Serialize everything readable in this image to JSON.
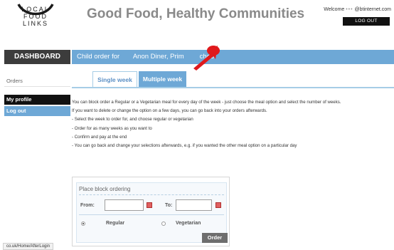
{
  "branding": {
    "logo_lines": [
      "LOCAL",
      "FOOD",
      "LINKS"
    ],
    "site_title": "Good Food, Healthy Communities"
  },
  "account": {
    "welcome_label": "Welcome",
    "email_masked": "•••",
    "email_domain": "@btinternet.com",
    "logout_label": "LOG OUT"
  },
  "nav": {
    "dashboard_label": "DASHBOARD",
    "sidebar": {
      "section_label": "Orders",
      "items": [
        {
          "label": "My profile",
          "active": true
        },
        {
          "label": "Log out",
          "active": false
        }
      ]
    }
  },
  "header": {
    "prefix": "Child order for",
    "child_name": "Anon Diner,",
    "school_partial": "Prim",
    "school_suffix": "chool"
  },
  "tabs": [
    {
      "label": "Single week",
      "active": false
    },
    {
      "label": "Multiple week",
      "active": true
    }
  ],
  "instructions": {
    "intro": "You can block order a Regular or a Vegetarian meal for every day of the week - just choose the meal option and select the number of weeks.",
    "note": "If you want to delete or change the option on a few days, you can go back into your orders afterwards.",
    "steps": [
      "- Select the week to order for, and choose regular or vegetarian",
      "- Order for as many weeks as you want to",
      "- Confirm and pay at the end",
      "- You can go back and change your selections afterwards, e.g. if you wanted the other meal option on a particular day"
    ]
  },
  "block_order": {
    "title": "Place block ordering",
    "from_label": "From:",
    "from_value": "",
    "to_label": "To:",
    "to_value": "",
    "options": [
      {
        "label": "Regular",
        "selected": true
      },
      {
        "label": "Vegetarian",
        "selected": false
      }
    ],
    "order_button": "Order"
  },
  "status_bar": {
    "url": "co.uk/Home/AfterLogin"
  },
  "colors": {
    "accent_blue": "#6ea8d6",
    "dark": "#3c3c3c",
    "annotation_red": "#e0191c"
  }
}
